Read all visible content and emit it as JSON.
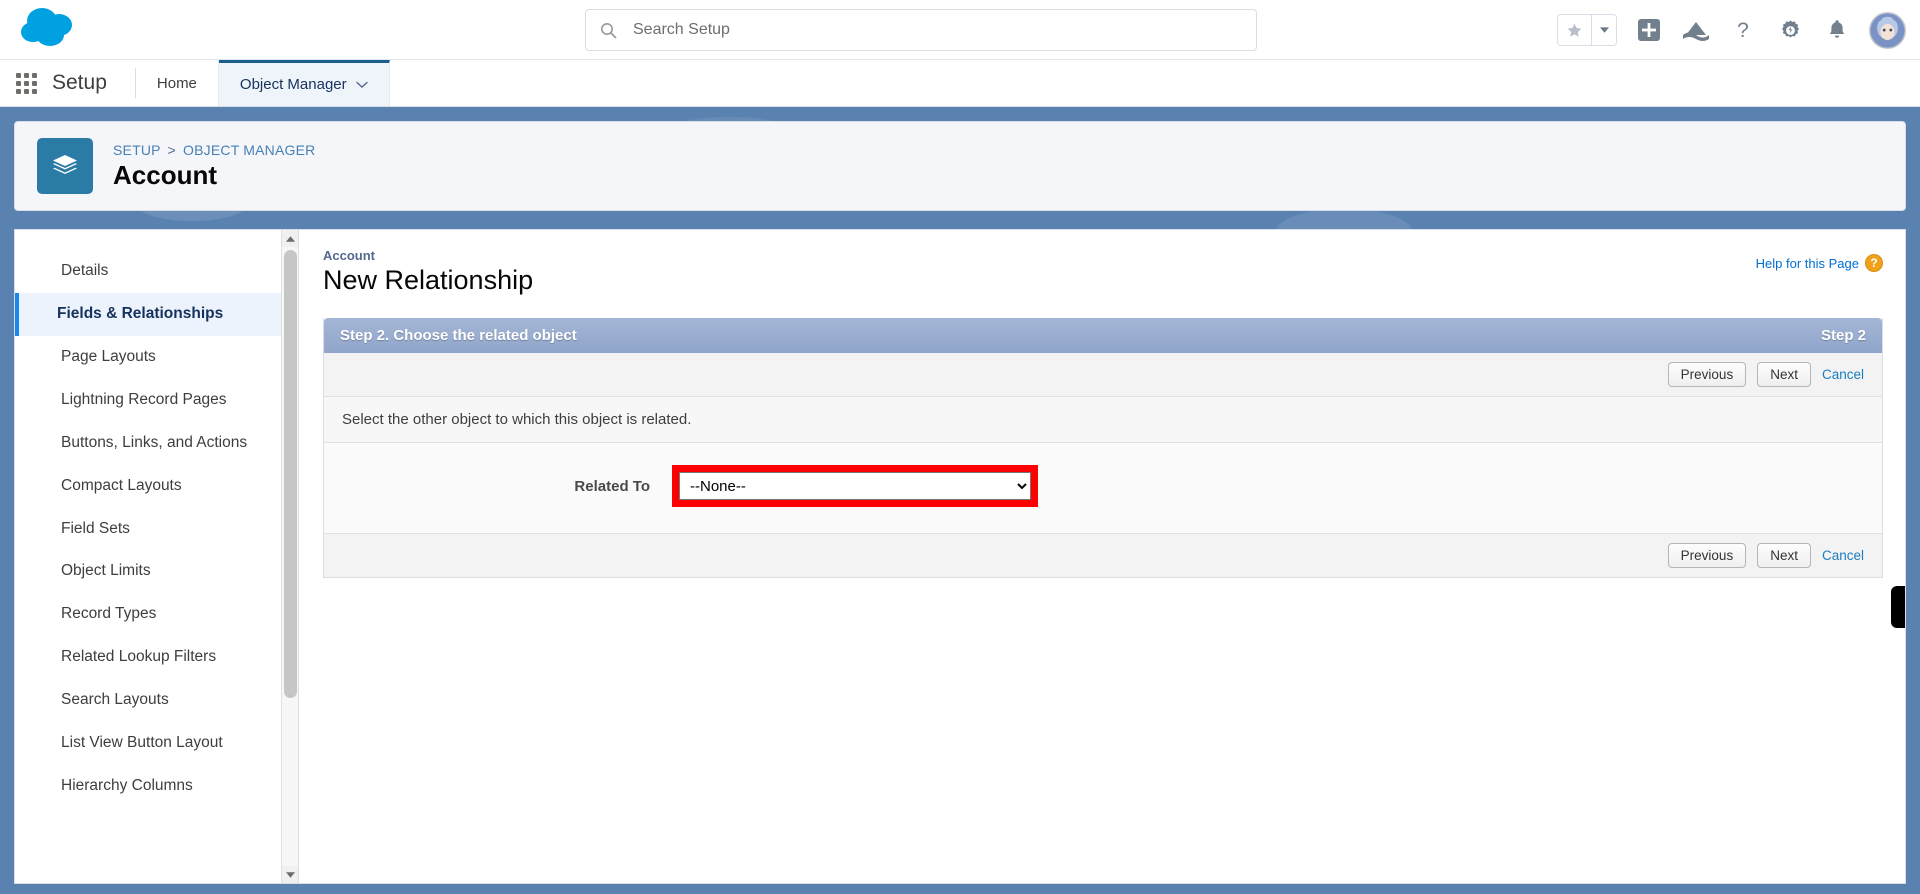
{
  "global_header": {
    "logo": "salesforce-cloud-logo",
    "search": {
      "placeholder": "Search Setup",
      "value": "",
      "icon": "search-icon"
    },
    "icons": [
      {
        "name": "favorites-star-icon",
        "glyph": "★"
      },
      {
        "name": "favorites-dropdown-caret-icon",
        "glyph": "▾"
      },
      {
        "name": "add-icon",
        "glyph": "+"
      },
      {
        "name": "einstein-icon",
        "glyph": "▲"
      },
      {
        "name": "help-icon",
        "glyph": "?"
      },
      {
        "name": "setup-gear-icon",
        "glyph": "⚙"
      },
      {
        "name": "notifications-bell-icon",
        "glyph": "🔔"
      },
      {
        "name": "user-avatar",
        "glyph": ""
      }
    ]
  },
  "setup_nav": {
    "app_launcher": "app-launcher-waffle-icon",
    "title": "Setup",
    "tabs": [
      {
        "label": "Home",
        "active": false,
        "has_caret": false
      },
      {
        "label": "Object Manager",
        "active": true,
        "has_caret": true
      }
    ]
  },
  "record_header": {
    "icon": "object-layers-icon",
    "breadcrumb": {
      "items": [
        "SETUP",
        "OBJECT MANAGER"
      ],
      "separator": ">"
    },
    "title": "Account"
  },
  "sidebar": {
    "items": [
      {
        "label": "Details",
        "active": false
      },
      {
        "label": "Fields & Relationships",
        "active": true
      },
      {
        "label": "Page Layouts",
        "active": false
      },
      {
        "label": "Lightning Record Pages",
        "active": false
      },
      {
        "label": "Buttons, Links, and Actions",
        "active": false
      },
      {
        "label": "Compact Layouts",
        "active": false
      },
      {
        "label": "Field Sets",
        "active": false
      },
      {
        "label": "Object Limits",
        "active": false
      },
      {
        "label": "Record Types",
        "active": false
      },
      {
        "label": "Related Lookup Filters",
        "active": false
      },
      {
        "label": "Search Layouts",
        "active": false
      },
      {
        "label": "List View Button Layout",
        "active": false
      },
      {
        "label": "Hierarchy Columns",
        "active": false
      }
    ],
    "scrollbar": {
      "up_arrow": "scroll-up-arrow-icon",
      "down_arrow": "scroll-down-arrow-icon"
    }
  },
  "main": {
    "object_label": "Account",
    "page_title": "New Relationship",
    "help_link": {
      "label": "Help for this Page",
      "icon": "help-question-icon"
    },
    "wizard": {
      "step_title": "Step 2. Choose the related object",
      "step_badge": "Step 2",
      "instruction": "Select the other object to which this object is related.",
      "buttons": {
        "previous": "Previous",
        "next": "Next",
        "cancel": "Cancel"
      },
      "field": {
        "label": "Related To",
        "selected_value": "--None--",
        "options": [
          "--None--"
        ],
        "highlighted": true,
        "highlight_color": "#ff0000"
      }
    }
  },
  "colors": {
    "brand_blue": "#1589ee",
    "backdrop_blue": "#5a82b1",
    "step_bar": "#9baed1",
    "link_blue": "#0070d2",
    "annotation_red": "#ff0000"
  }
}
